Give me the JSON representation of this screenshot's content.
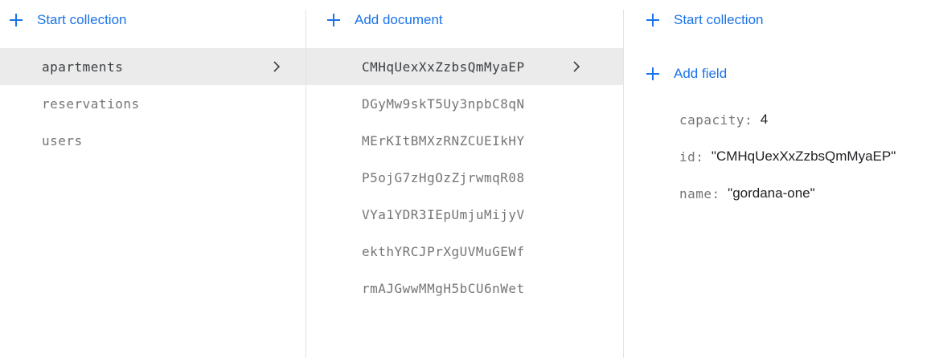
{
  "collections_panel": {
    "add_label": "Start collection",
    "items": [
      {
        "label": "apartments",
        "selected": true
      },
      {
        "label": "reservations",
        "selected": false
      },
      {
        "label": "users",
        "selected": false
      }
    ]
  },
  "documents_panel": {
    "add_label": "Add document",
    "items": [
      {
        "label": "CMHqUexXxZzbsQmMyaEP",
        "selected": true
      },
      {
        "label": "DGyMw9skT5Uy3npbC8qN",
        "selected": false
      },
      {
        "label": "MErKItBMXzRNZCUEIkHY",
        "selected": false
      },
      {
        "label": "P5ojG7zHgOzZjrwmqR08",
        "selected": false
      },
      {
        "label": "VYa1YDR3IEpUmjuMijyV",
        "selected": false
      },
      {
        "label": "ekthYRCJPrXgUVMuGEWf",
        "selected": false
      },
      {
        "label": "rmAJGwwMMgH5bCU6nWet",
        "selected": false
      }
    ]
  },
  "fields_panel": {
    "start_collection_label": "Start collection",
    "add_field_label": "Add field",
    "fields": [
      {
        "key": "capacity",
        "value": "4"
      },
      {
        "key": "id",
        "value": "\"CMHqUexXxZzbsQmMyaEP\""
      },
      {
        "key": "name",
        "value": "\"gordana-one\""
      }
    ]
  },
  "icons": {
    "add": "plus-icon",
    "expand": "chevron-right-icon"
  },
  "colors": {
    "accent": "#1a73e8",
    "selected_row": "#ebebeb",
    "muted_text": "#757575"
  }
}
